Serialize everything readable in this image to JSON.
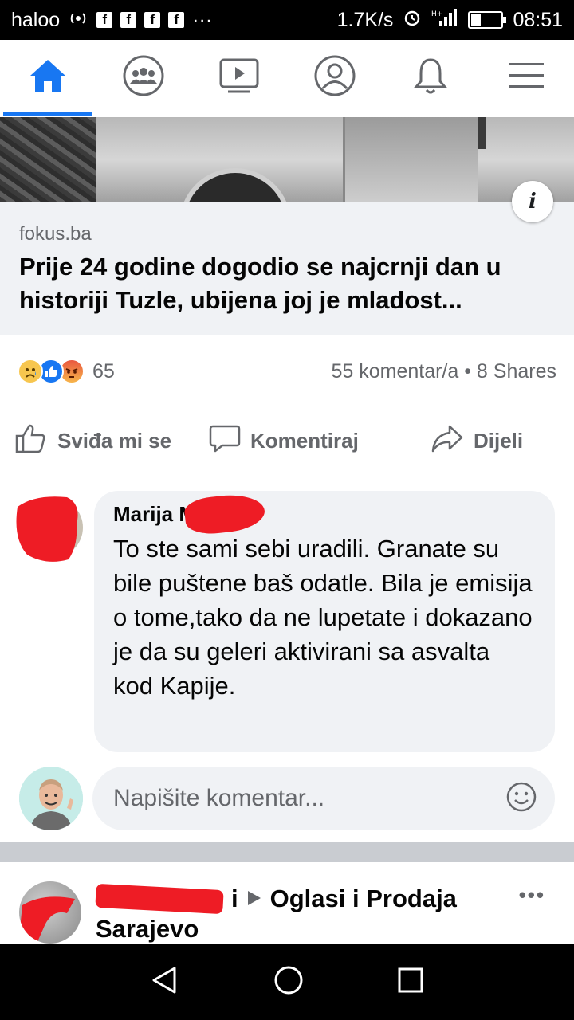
{
  "status_bar": {
    "carrier": "haloo",
    "speed": "1.7K/s",
    "time": "08:51",
    "notification_icons": [
      "f",
      "f",
      "f",
      "f"
    ],
    "more": "···"
  },
  "nav": {
    "tabs": [
      {
        "name": "home-icon",
        "active": true
      },
      {
        "name": "groups-icon",
        "active": false
      },
      {
        "name": "watch-icon",
        "active": false
      },
      {
        "name": "profile-icon",
        "active": false
      },
      {
        "name": "bell-icon",
        "active": false
      },
      {
        "name": "menu-icon",
        "active": false
      }
    ],
    "accent": "#1877f2"
  },
  "link_preview": {
    "info_label": "i",
    "domain": "fokus.ba",
    "title": "Prije 24 godine dogodio se najcrnji dan u historiji Tuzle, ubijena joj je mladost..."
  },
  "reactions": {
    "types": [
      "sad",
      "like",
      "angry"
    ],
    "count": "65",
    "stats": "55 komentar/a • 8 Shares"
  },
  "actions": {
    "like": "Sviđa mi se",
    "comment": "Komentiraj",
    "share": "Dijeli"
  },
  "comment": {
    "author": "Marija M",
    "text": "To ste sami sebi uradili. Granate su bile puštene baš odatle. Bila je  emisija o tome,tako da ne lupetate i dokazano je da su geleri aktivirani sa asvalta kod Kapije."
  },
  "compose": {
    "placeholder": "Napišite komentar..."
  },
  "next_post": {
    "poster_fragment": "i",
    "group": "Oglasi i Prodaja",
    "group_line2": "Sarajevo",
    "more": "•••"
  }
}
